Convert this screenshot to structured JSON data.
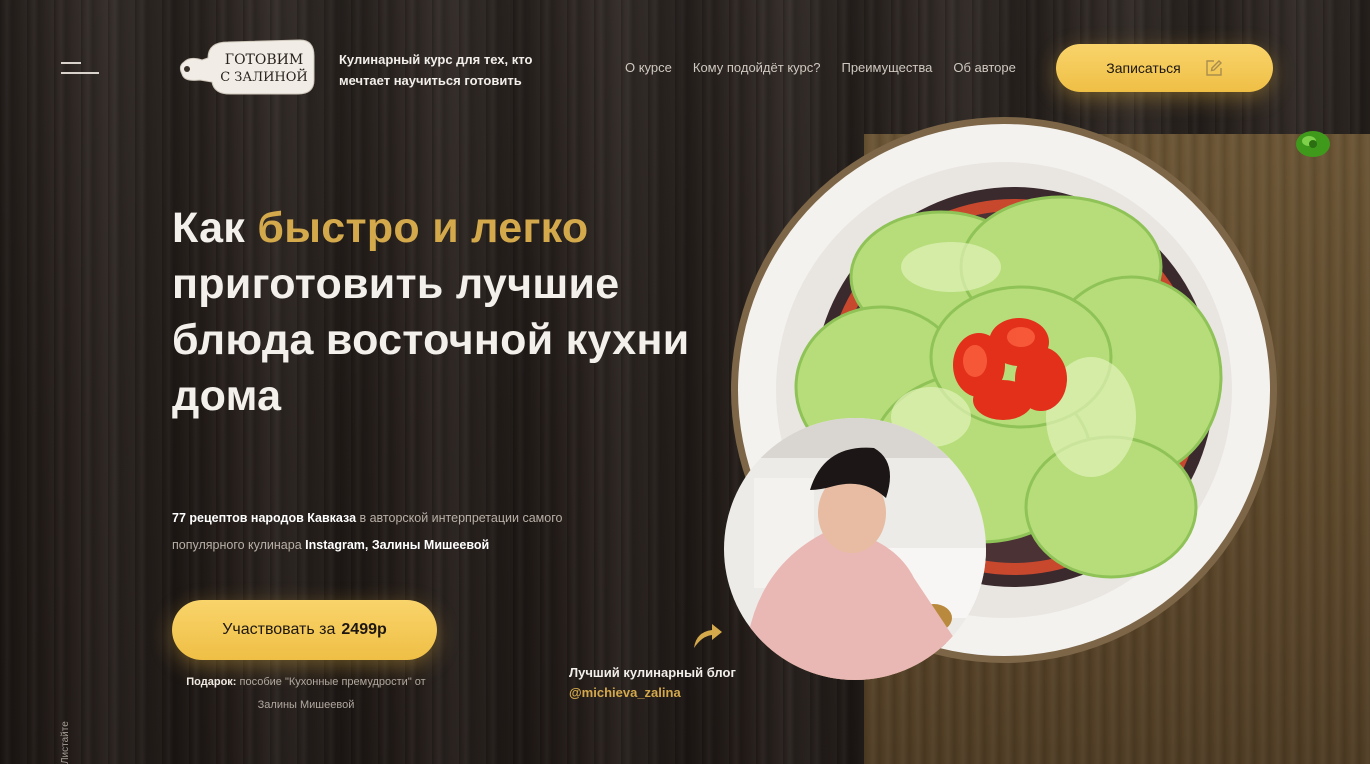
{
  "header": {
    "logo_line1": "ГОТОВИМ",
    "logo_line2": "С ЗАЛИНОЙ",
    "tagline": "Кулинарный курс для тех, кто мечтает научиться готовить",
    "nav": [
      "О курсе",
      "Кому подойдёт курс?",
      "Преимущества",
      "Об авторе"
    ],
    "signup_label": "Записаться"
  },
  "hero": {
    "title_start": "Как ",
    "title_accent": "быстро и легко",
    "title_rest": " приготовить лучшие блюда восточной кухни дома",
    "desc_bold1": "77 рецептов народов Кавказа",
    "desc_text1": " в авторской интерпретации самого популярного кулинара ",
    "desc_bold2": "Instagram, Залины Мишеевой",
    "cta_text": "Участвовать за ",
    "cta_price": "2499р",
    "gift_bold": "Подарок:",
    "gift_text": " пособие \"Кухонные премудрости\" от Залины Мишеевой",
    "scroll_hint": "Листайте"
  },
  "blog": {
    "label": "Лучший кулинарный блог ",
    "handle": "@michieva_zalina"
  },
  "colors": {
    "accent_gold": "#d4a94c",
    "button_gold": "#f5c95a",
    "wood_dark": "#2a221e",
    "board_brown": "#5e482c"
  },
  "icons": [
    "menu-icon",
    "edit-icon",
    "arrow-icon",
    "pepper-icon"
  ]
}
